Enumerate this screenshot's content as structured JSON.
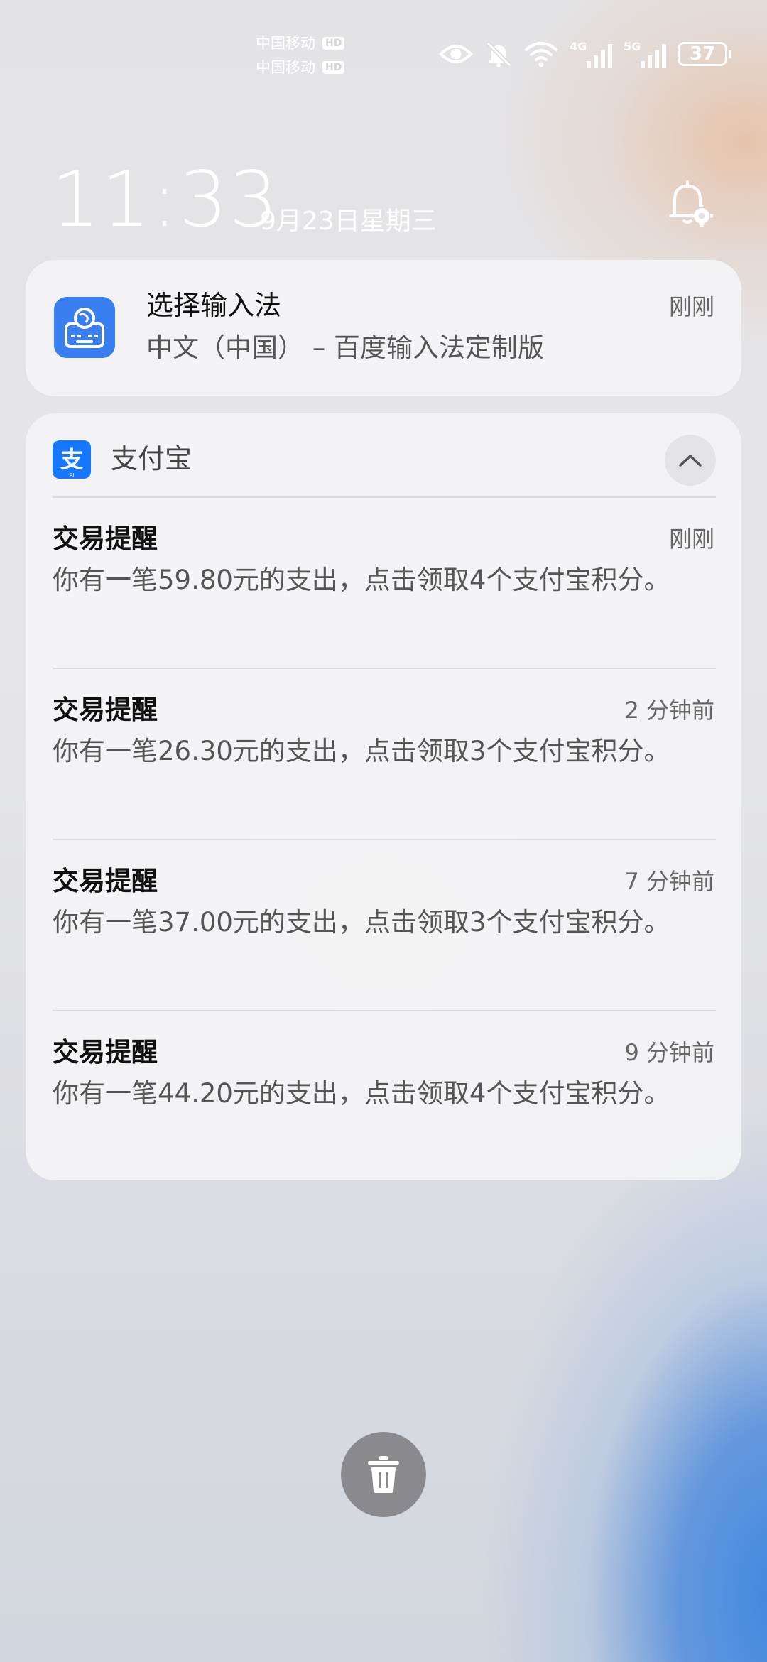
{
  "status_bar": {
    "carriers": [
      {
        "name": "中国移动",
        "badge": "HD"
      },
      {
        "name": "中国移动",
        "badge": "HD"
      }
    ],
    "signal_1_tag": "4G",
    "signal_2_tag": "5G",
    "battery": "37",
    "icons": [
      "eye-icon",
      "bell-off-icon",
      "wifi-icon",
      "signal-4g-icon",
      "signal-5g-icon",
      "battery-icon"
    ]
  },
  "lockscreen": {
    "time": "11:33",
    "date": "9月23日星期三",
    "settings_icon": "bell-settings-icon"
  },
  "ime_notification": {
    "title": "选择输入法",
    "subtitle": "中文（中国） – 百度输入法定制版",
    "time": "刚刚",
    "icon": "keyboard-globe-icon"
  },
  "alipay_group": {
    "app_name": "支付宝",
    "icon": "alipay-logo-icon",
    "collapse_icon": "chevron-up-icon",
    "notifications": [
      {
        "title": "交易提醒",
        "time": "刚刚",
        "body": "你有一笔59.80元的支出，点击领取4个支付宝积分。"
      },
      {
        "title": "交易提醒",
        "time": "2 分钟前",
        "body": "你有一笔26.30元的支出，点击领取3个支付宝积分。"
      },
      {
        "title": "交易提醒",
        "time": "7 分钟前",
        "body": "你有一笔37.00元的支出，点击领取3个支付宝积分。"
      },
      {
        "title": "交易提醒",
        "time": "9 分钟前",
        "body": "你有一笔44.20元的支出，点击领取4个支付宝积分。"
      }
    ]
  },
  "clear_all": {
    "icon": "trash-icon"
  }
}
